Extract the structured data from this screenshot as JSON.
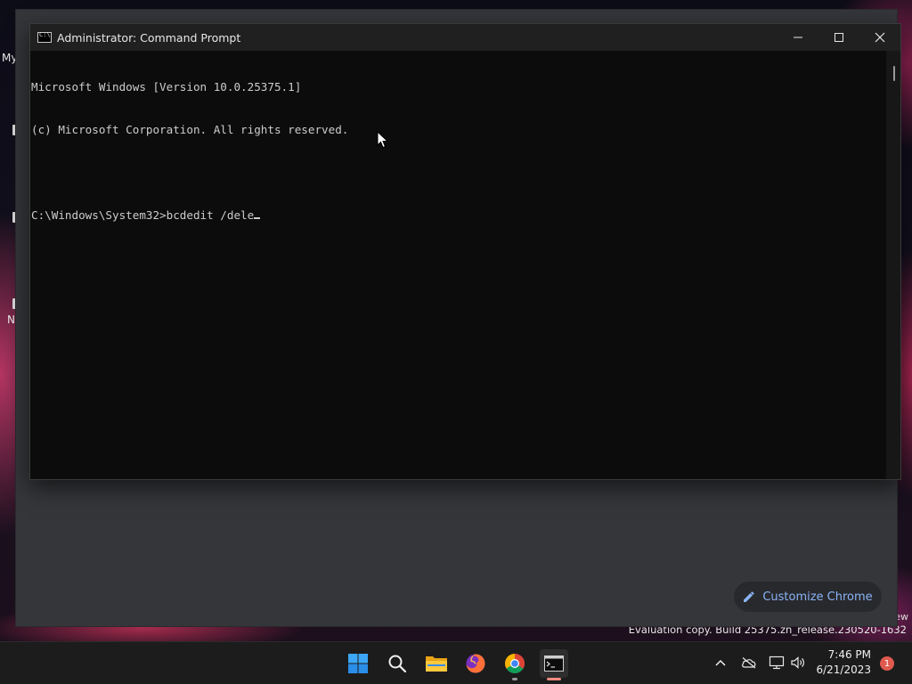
{
  "desktop": {
    "label_fragments": [
      "My",
      "N"
    ],
    "watermark": "Evaluation copy. Build 25375.zn_release.230520-1632",
    "watermark_fragment": "ew"
  },
  "chrome": {
    "customize_label": "Customize Chrome",
    "accent_color": "#8ab4f8"
  },
  "cmd": {
    "title": "Administrator: Command Prompt",
    "lines": [
      "Microsoft Windows [Version 10.0.25375.1]",
      "(c) Microsoft Corporation. All rights reserved.",
      "",
      "C:\\Windows\\System32>bcdedit /dele"
    ],
    "icons": {
      "minimize": "minimize-icon",
      "maximize": "maximize-icon",
      "close": "close-icon"
    }
  },
  "taskbar": {
    "apps": [
      {
        "name": "Start",
        "icon": "windows-start-icon"
      },
      {
        "name": "Search",
        "icon": "search-icon"
      },
      {
        "name": "File Explorer",
        "icon": "folder-icon"
      },
      {
        "name": "Firefox",
        "icon": "firefox-icon"
      },
      {
        "name": "Google Chrome",
        "icon": "chrome-icon"
      },
      {
        "name": "Command Prompt",
        "icon": "terminal-icon"
      }
    ],
    "tray": {
      "time": "7:46 PM",
      "date": "6/21/2023",
      "notification_count": "1"
    }
  }
}
